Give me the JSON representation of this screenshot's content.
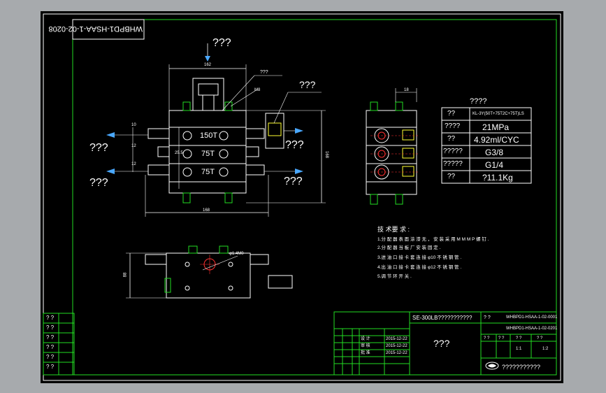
{
  "drawing_no_rotated": "WHBPD1-HSAA-1-02-0208",
  "markers": {
    "top_arrow": "???",
    "left_upper": "???",
    "left_lower": "???",
    "right_mid": "???",
    "right_lower": "???",
    "leader_top": "???",
    "callout": "???"
  },
  "port_labels": [
    "150T",
    "75T",
    "75T"
  ],
  "spec_table": {
    "title": "????",
    "rows": [
      {
        "k": "??",
        "v": "KL-3Y(50T+75T2C+75T)LS"
      },
      {
        "k": "????",
        "v": "21MPa"
      },
      {
        "k": "??",
        "v": "4.92ml/CYC"
      },
      {
        "k": "?????",
        "v": "G3/8"
      },
      {
        "k": "?????",
        "v": "G1/4"
      },
      {
        "k": "??",
        "v": "?11.1Kg"
      }
    ]
  },
  "notes": {
    "title": "技 术要 求 :",
    "lines": [
      "1.分 配 器 表 面 涂 漆 无 ， 安 装 采 用 M M M P 螺 钉 .",
      "2.分 配 器 当 板 厂 安 装 固 定 .",
      "3.进 油 口 接 卡 套 连 接 φ10 不 锈 钢 管 .",
      "4.出 油 口 接 卡 套 连 接 φ12 不 锈 钢 管 .",
      "5.调 节 环 开 关 ."
    ]
  },
  "left_strip": [
    "? ?",
    "? ?",
    "? ?",
    "? ?",
    "? ?",
    "? ?"
  ],
  "title_block": {
    "product": "SE-300LB???????????",
    "code1": "WHBPD1-HSAA-1-02-0001",
    "code2": "WHBPD1-HSAA-1-02-0201",
    "name": "???",
    "scale_row": [
      "? ?",
      "? ?",
      "? ?",
      "? ?"
    ],
    "scale_vals": [
      "1:1",
      "1:2"
    ],
    "company": "???????????",
    "dates": [
      "2015-12-22",
      "2015-12-22",
      "2015-12-22"
    ],
    "roles": [
      "设 计",
      "审 核",
      "批 准"
    ],
    "small": "? ?"
  },
  "dims": {
    "top_w": "162",
    "base_w": "168",
    "right_h": "168",
    "side_w": "18",
    "bot_h": "88",
    "bolt": "M8",
    "ang": "φ1.4M0",
    "in_a": "10",
    "in_b": "12",
    "in_c": "12",
    "pitch": "25.5"
  }
}
